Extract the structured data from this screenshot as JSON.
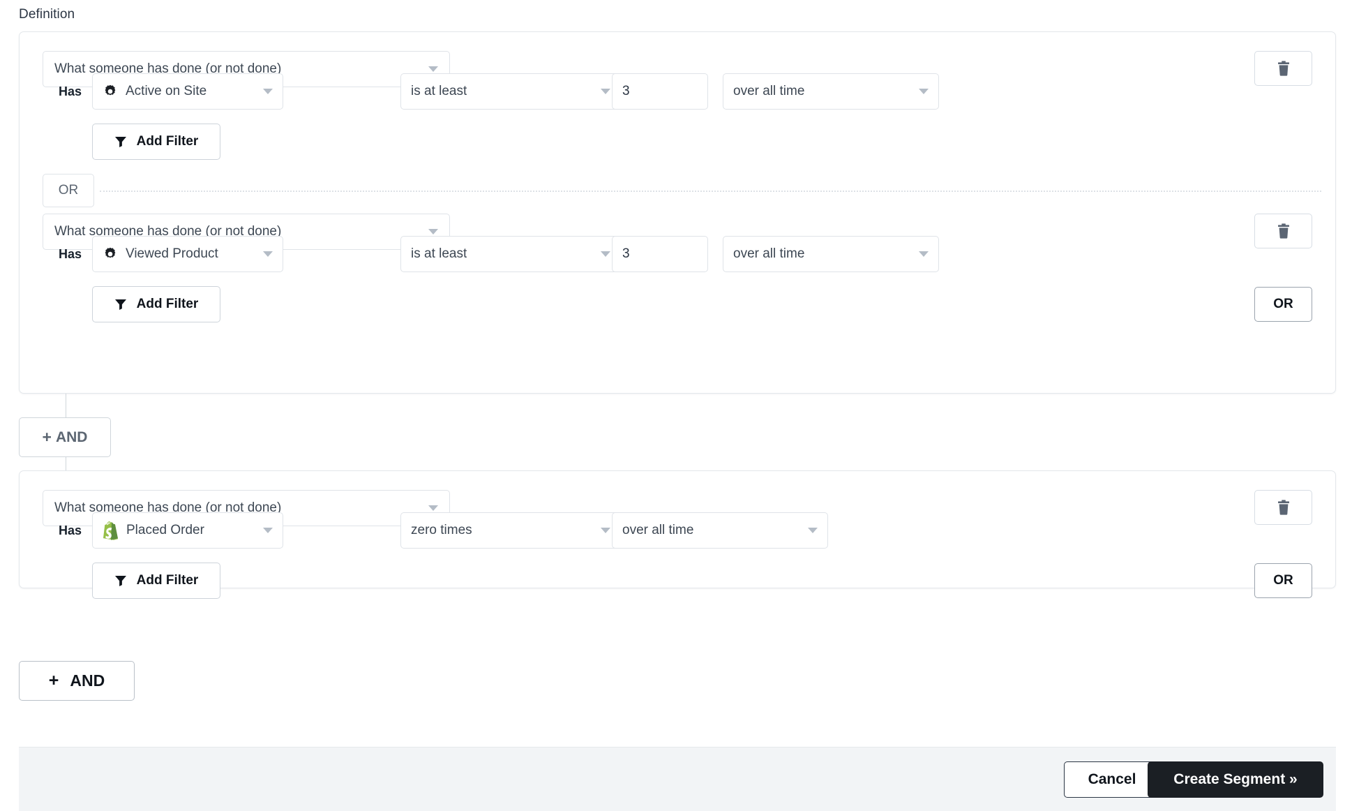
{
  "section": {
    "title": "Definition"
  },
  "labels": {
    "has": "Has",
    "or": "OR",
    "and": "AND",
    "plus": "+",
    "add_filter": "Add Filter"
  },
  "icons": {
    "gear": "gear-icon",
    "shopify": "shopify-icon",
    "funnel": "funnel-icon",
    "trash": "trash-icon",
    "caret": "chevron-down-icon"
  },
  "colors": {
    "page_bg": "#ffffff",
    "card_border": "#e3e7eb",
    "control_border": "#dfe3e8",
    "text": "#3d4753",
    "muted_text": "#5c6672",
    "footer_bg": "#f2f4f6",
    "primary_button_bg": "#1b1f24",
    "primary_button_text": "#ffffff",
    "shopify_green": "#95bf47",
    "connector_line": "#cfd5db"
  },
  "groups": [
    {
      "conditions": [
        {
          "type_label": "What someone has done (or not done)",
          "has_label": "Has",
          "metric": "Active on Site",
          "metric_icon": "gear-icon",
          "operator": "is at least",
          "value": "3",
          "timeframe": "over all time",
          "add_filter_label": "Add Filter",
          "has_value_box": true,
          "or_button_label": null
        },
        {
          "type_label": "What someone has done (or not done)",
          "has_label": "Has",
          "metric": "Viewed Product",
          "metric_icon": "gear-icon",
          "operator": "is at least",
          "value": "3",
          "timeframe": "over all time",
          "add_filter_label": "Add Filter",
          "has_value_box": true,
          "or_button_label": "OR"
        }
      ],
      "divider_label": "OR"
    },
    {
      "conditions": [
        {
          "type_label": "What someone has done (or not done)",
          "has_label": "Has",
          "metric": "Placed Order",
          "metric_icon": "shopify-icon",
          "operator": "zero times",
          "value": null,
          "timeframe": "over all time",
          "add_filter_label": "Add Filter",
          "has_value_box": false,
          "or_button_label": "OR"
        }
      ]
    }
  ],
  "and_buttons": {
    "mid_label": "AND",
    "mid_plus": "+",
    "bottom_label": "AND",
    "bottom_plus": "+"
  },
  "footer": {
    "cancel_label": "Cancel",
    "create_label": "Create Segment »"
  }
}
